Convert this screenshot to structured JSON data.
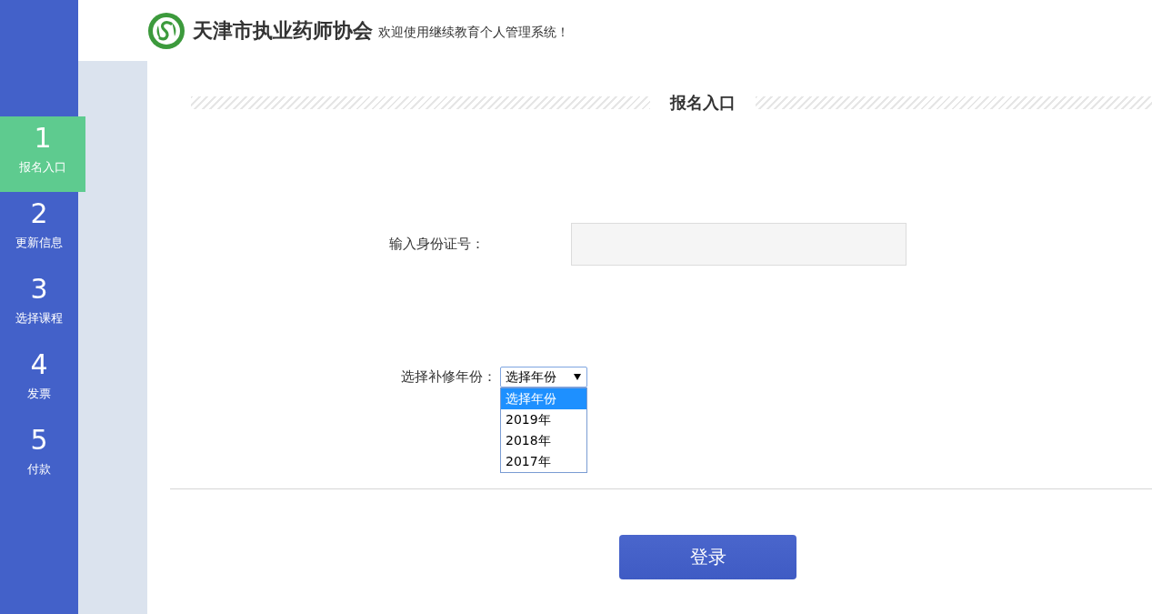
{
  "header": {
    "org_name": "天津市执业药师协会",
    "welcome": "欢迎使用继续教育个人管理系统！"
  },
  "steps": [
    {
      "number": "1",
      "label": "报名入口",
      "selected": true
    },
    {
      "number": "2",
      "label": "更新信息",
      "selected": false
    },
    {
      "number": "3",
      "label": "选择课程",
      "selected": false
    },
    {
      "number": "4",
      "label": "发票",
      "selected": false
    },
    {
      "number": "5",
      "label": "付款",
      "selected": false
    }
  ],
  "section_title": "报名入口",
  "form": {
    "id_field": {
      "label": "输入身份证号："
    },
    "year_select": {
      "label": "选择补修年份：",
      "value": "选择年份",
      "expanded": true,
      "options": [
        {
          "label": "选择年份",
          "selected": true
        },
        {
          "label": "2019年",
          "selected": false
        },
        {
          "label": "2018年",
          "selected": false
        },
        {
          "label": "2017年",
          "selected": false
        }
      ]
    }
  },
  "submit_button": "登录"
}
